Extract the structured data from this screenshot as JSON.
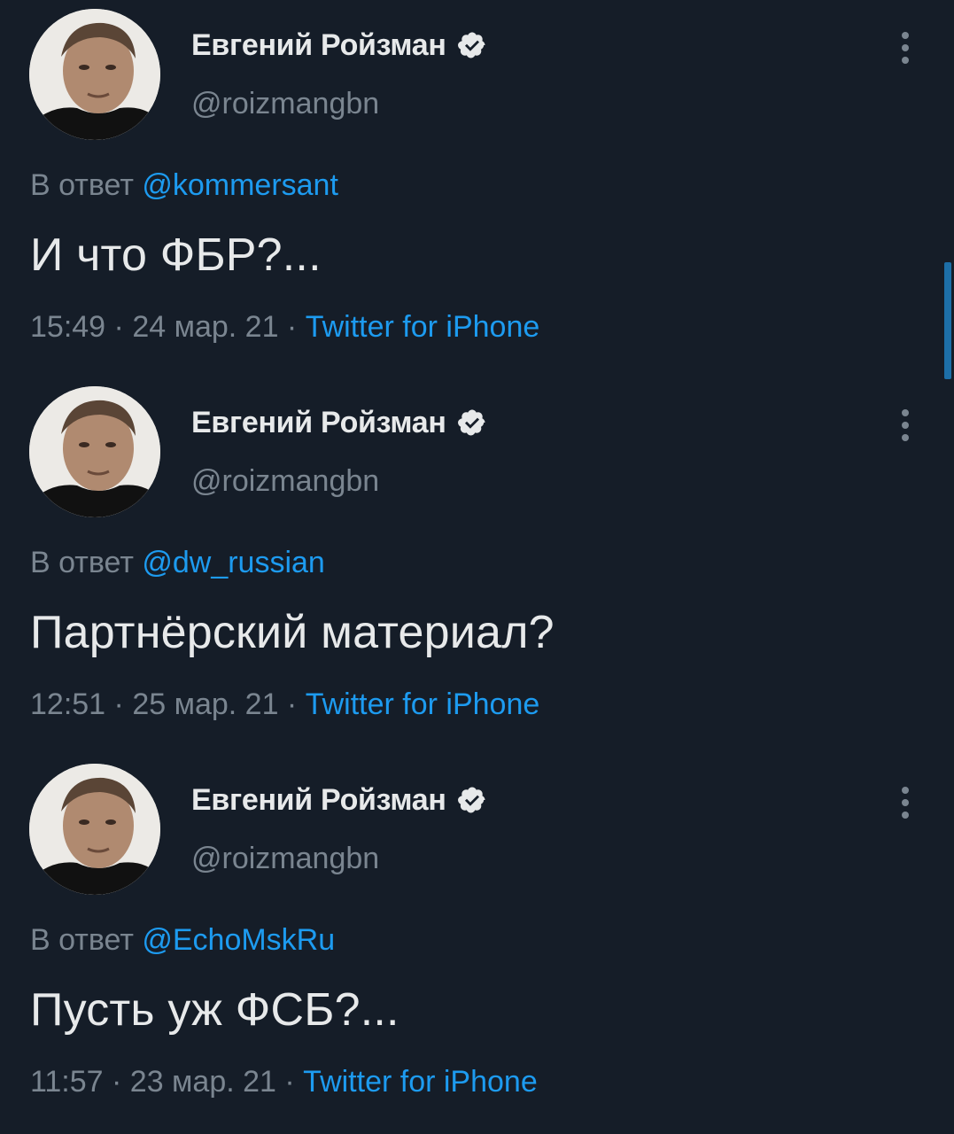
{
  "tweets": [
    {
      "author": {
        "name": "Евгений Ройзман",
        "handle": "@roizmangbn"
      },
      "reply_prefix": "В ответ ",
      "reply_to": "@kommersant",
      "text": "И что ФБР?...",
      "time": "15:49",
      "date": "24 мар. 21",
      "separator": " · ",
      "source": "Twitter for iPhone"
    },
    {
      "author": {
        "name": "Евгений Ройзман",
        "handle": "@roizmangbn"
      },
      "reply_prefix": "В ответ ",
      "reply_to": "@dw_russian",
      "text": "Партнёрский материал?",
      "time": "12:51",
      "date": "25 мар. 21",
      "separator": " · ",
      "source": "Twitter for iPhone"
    },
    {
      "author": {
        "name": "Евгений Ройзман",
        "handle": "@roizmangbn"
      },
      "reply_prefix": "В ответ ",
      "reply_to": "@EchoMskRu",
      "text": "Пусть уж ФСБ?...",
      "time": "11:57",
      "date": "23 мар. 21",
      "separator": " · ",
      "source": "Twitter for iPhone"
    }
  ],
  "icons": {
    "verified": "verified-badge-icon",
    "more": "more-vertical-icon"
  },
  "colors": {
    "background": "#151d28",
    "text_primary": "#e7e9ea",
    "text_secondary": "#7a8590",
    "accent": "#1d9bf0"
  }
}
